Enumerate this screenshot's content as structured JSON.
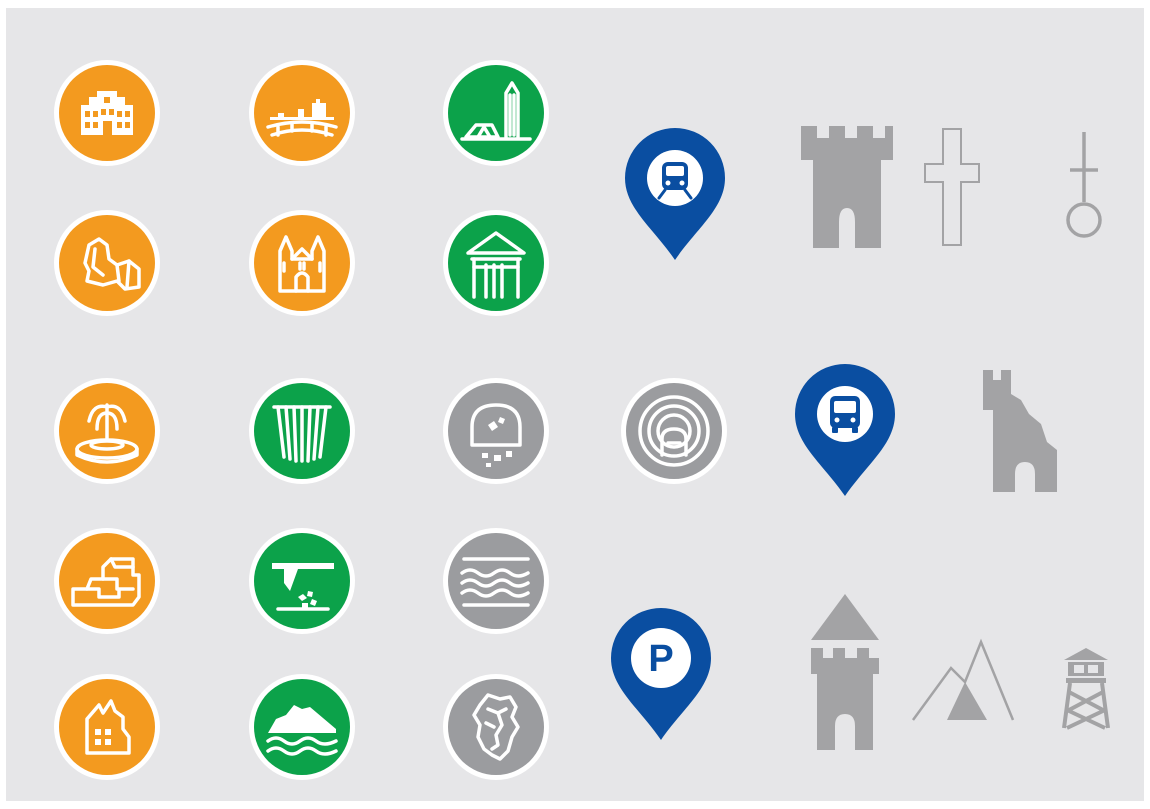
{
  "colors": {
    "background": "#e6e6e8",
    "badge_orange": "#f39a1f",
    "badge_green": "#0ca24a",
    "badge_gray": "#9b9c9f",
    "pin_blue": "#0a4ea1",
    "symbol_gray": "#a3a3a5"
  },
  "badges": [
    {
      "name": "palace-icon",
      "color": "orange"
    },
    {
      "name": "town-panorama-icon",
      "color": "orange"
    },
    {
      "name": "tower-monument-icon",
      "color": "green"
    },
    {
      "name": "rock-formation-icon",
      "color": "orange"
    },
    {
      "name": "church-icon",
      "color": "orange"
    },
    {
      "name": "gate-pavilion-icon",
      "color": "green"
    },
    {
      "name": "fountain-icon",
      "color": "orange"
    },
    {
      "name": "waterfall-icon",
      "color": "green"
    },
    {
      "name": "cave-mine-icon",
      "color": "gray"
    },
    {
      "name": "ruins-icon",
      "color": "orange"
    },
    {
      "name": "quarry-icon",
      "color": "green"
    },
    {
      "name": "water-waves-icon",
      "color": "gray"
    },
    {
      "name": "castle-ruin-icon",
      "color": "orange"
    },
    {
      "name": "cliff-coast-icon",
      "color": "green"
    },
    {
      "name": "region-map-icon",
      "color": "gray"
    },
    {
      "name": "tunnel-icon",
      "color": "gray"
    }
  ],
  "pins": [
    {
      "name": "train-pin-icon"
    },
    {
      "name": "bus-pin-icon"
    },
    {
      "name": "parking-pin-icon",
      "letter": "P"
    }
  ],
  "symbols": [
    "castle-tower-icon",
    "outline-cross-icon",
    "cross-with-circle-icon",
    "ruined-tower-icon",
    "tower-with-roof-icon",
    "mountain-icon",
    "watchtower-icon"
  ]
}
